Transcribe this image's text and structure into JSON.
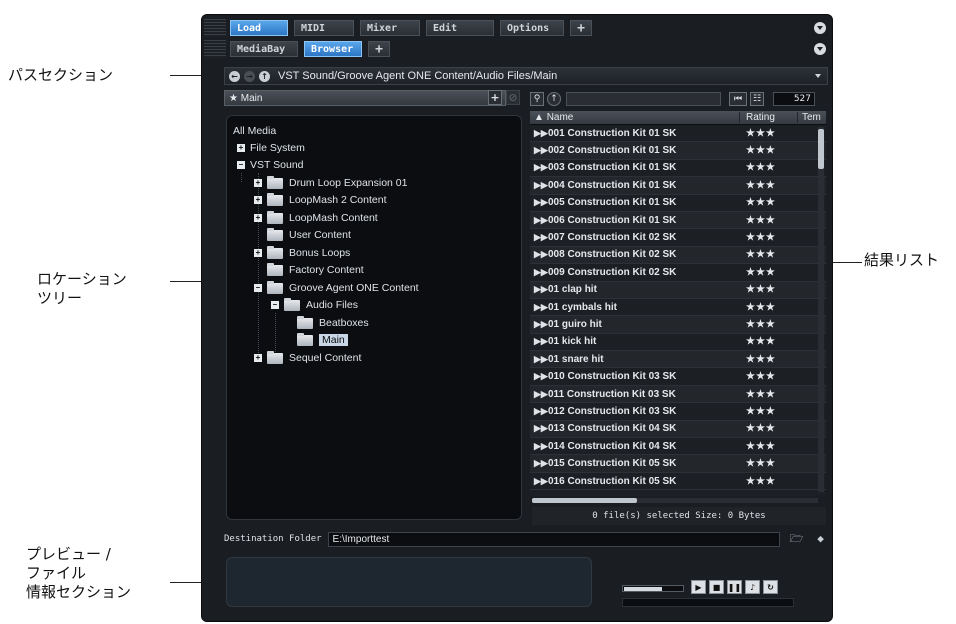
{
  "callouts": {
    "path_section": "パスセクション",
    "location_tree_1": "ロケーション",
    "location_tree_2": "ツリー",
    "results_list": "結果リスト",
    "preview_1": "プレビュー /",
    "preview_2": "ファイル",
    "preview_3": "情報セクション"
  },
  "tabs_row1": [
    "Load",
    "MIDI",
    "Mixer",
    "Edit",
    "Options",
    "+"
  ],
  "tabs_row2": [
    "MediaBay",
    "Browser",
    "+"
  ],
  "path": {
    "text": "VST Sound/Groove Agent ONE Content/Audio Files/Main"
  },
  "location_preset": "★ Main",
  "tree": {
    "root": "All Media",
    "items": [
      "File System",
      "VST Sound",
      "Drum Loop Expansion 01",
      "LoopMash 2 Content",
      "LoopMash Content",
      "User Content",
      "Bonus Loops",
      "Factory Content",
      "Groove Agent ONE Content",
      "Audio Files",
      "Beatboxes",
      "Main",
      "Sequel Content"
    ]
  },
  "results": {
    "count": "527",
    "columns": {
      "name": "Name",
      "rating": "Rating",
      "tempo": "Tem"
    },
    "rating_stars": "★★★",
    "rows": [
      "001 Construction Kit 01 SK",
      "002 Construction Kit 01 SK",
      "003 Construction Kit 01 SK",
      "004 Construction Kit 01 SK",
      "005 Construction Kit 01 SK",
      "006 Construction Kit 01 SK",
      "007 Construction Kit 02 SK",
      "008 Construction Kit 02 SK",
      "009 Construction Kit 02 SK",
      "01 clap hit",
      "01 cymbals hit",
      "01 guiro hit",
      "01 kick hit",
      "01 snare hit",
      "010 Construction Kit 03 SK",
      "011 Construction Kit 03 SK",
      "012 Construction Kit 03 SK",
      "013 Construction Kit 04 SK",
      "014 Construction Kit 04 SK",
      "015 Construction Kit 05 SK",
      "016 Construction Kit 05 SK"
    ],
    "status": "0 file(s) selected  Size: 0 Bytes"
  },
  "destination": {
    "label": "Destination Folder",
    "value": "E:\\Importtest"
  },
  "colors": {
    "accent": "#3a8ddb",
    "panel_bg": "#1a1d22"
  }
}
